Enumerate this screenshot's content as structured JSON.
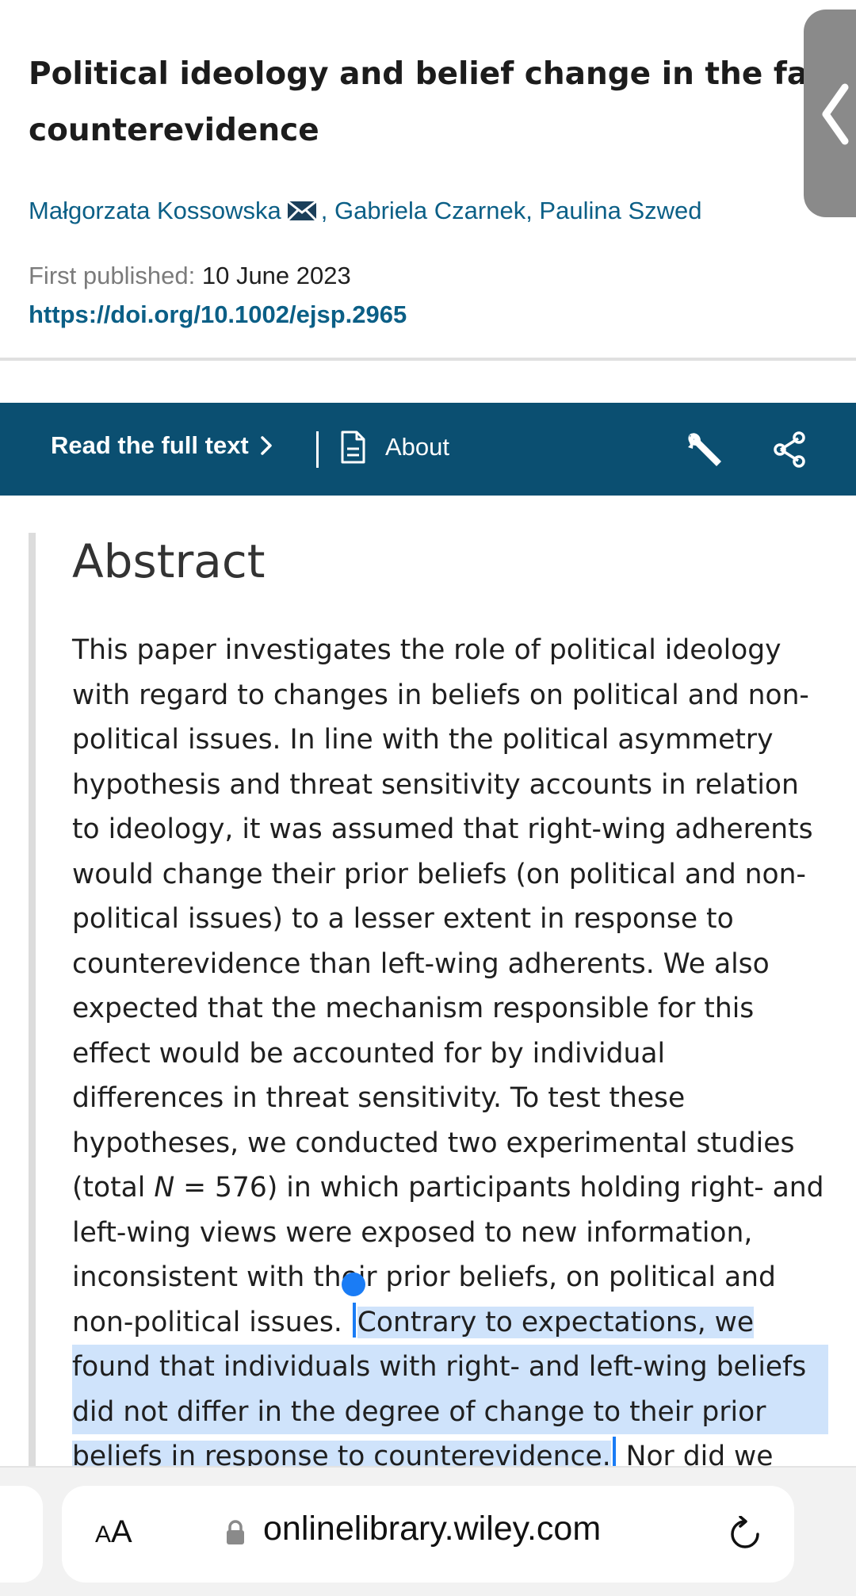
{
  "article": {
    "title_line1": "Political ideology and belief change in the face o",
    "title_line2": "counterevidence",
    "author1": "Małgorzata Kossowska",
    "authors_rest": ", Gabriela Czarnek, Paulina Szwed",
    "first_published_label": "First published:",
    "first_published_date": "10 June 2023",
    "doi": "https://doi.org/10.1002/ejsp.2965"
  },
  "toolbar": {
    "read_full_text": "Read the full text",
    "about": "About",
    "icons": [
      "chevron-right-icon",
      "document-icon",
      "wrench-icon",
      "share-icon"
    ]
  },
  "abstract": {
    "heading": "Abstract",
    "lines": [
      "This paper investigates the role of political ideology",
      "with regard to changes in beliefs on political and non-",
      "political issues. In line with the political asymmetry",
      "hypothesis and threat sensitivity accounts in relation",
      "to ideology, it was assumed that right-wing adherents",
      "would change their prior beliefs (on political and non-",
      "political issues) to a lesser extent in response to",
      "counterevidence than left-wing adherents. We also",
      "expected that the mechanism responsible for this",
      "effect would be accounted for by individual",
      "differences in threat sensitivity. To test these",
      "hypotheses, we conducted two experimental studies"
    ],
    "line13_before": "(total ",
    "line13_italic": "N",
    "line13_after": " = 576) in which participants holding right- and",
    "line14": "left-wing views were exposed to new information,",
    "line15": "inconsistent with their prior beliefs, on political and",
    "line16_plain": "non-political issues. ",
    "line16_selected": "Contrary to expectations, we",
    "line17_selected": "found that individuals with right- and left-wing beliefs",
    "line18_selected": "did not differ in the degree of change to their prior",
    "line19_selected": "beliefs in response to counterevidence.",
    "line19_plain": " Nor did we"
  },
  "browser": {
    "aa_label_small": "A",
    "aa_label_large": "A",
    "url": "onlinelibrary.wiley.com",
    "icons": [
      "lock-icon",
      "reload-icon"
    ]
  },
  "colors": {
    "link_blue": "#0b5f86",
    "toolbar_bg": "#0b4f71",
    "selection": "#cfe3fb",
    "selection_handle": "#1a7cf5"
  }
}
